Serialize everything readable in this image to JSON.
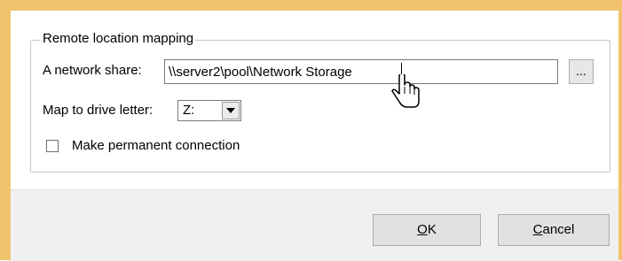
{
  "group": {
    "title": "Remote location mapping"
  },
  "share": {
    "label": "A network share:",
    "value": "\\\\server2\\pool\\Network Storage",
    "browse_label": "..."
  },
  "drive": {
    "label": "Map to drive letter:",
    "selected": "Z:"
  },
  "permanent": {
    "label": "Make permanent connection",
    "checked": false
  },
  "buttons": {
    "ok_mnemonic": "O",
    "ok_rest": "K",
    "cancel_mnemonic": "C",
    "cancel_rest": "ancel"
  },
  "colors": {
    "window_border": "#f1c36d",
    "button_face": "#e1e1e1",
    "panel": "#f0f0f0"
  }
}
